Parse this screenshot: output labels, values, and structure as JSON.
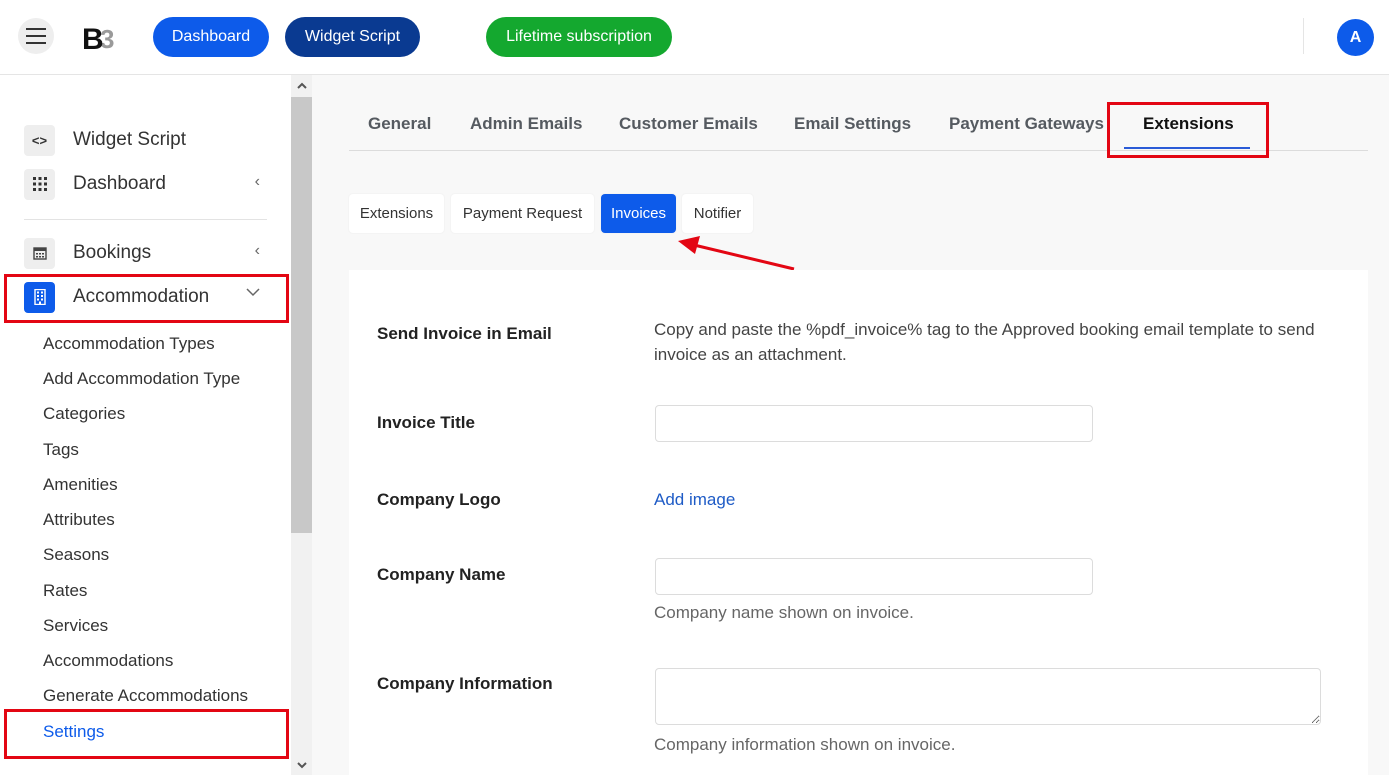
{
  "header": {
    "logo_text": "B3",
    "buttons": {
      "dashboard": "Dashboard",
      "widget_script": "Widget Script",
      "lifetime": "Lifetime subscription"
    },
    "avatar_initial": "A",
    "colors": {
      "primary": "#0d5bea",
      "dark_blue": "#0a3a91",
      "green": "#14a82f"
    }
  },
  "sidebar": {
    "items": [
      {
        "label": "Widget Script",
        "icon": "code-icon"
      },
      {
        "label": "Dashboard",
        "icon": "grid-icon"
      },
      {
        "label": "Bookings",
        "icon": "calendar-icon"
      },
      {
        "label": "Accommodation",
        "icon": "building-icon"
      }
    ],
    "submenu": [
      "Accommodation Types",
      "Add Accommodation Type",
      "Categories",
      "Tags",
      "Amenities",
      "Attributes",
      "Seasons",
      "Rates",
      "Services",
      "Accommodations",
      "Generate Accommodations",
      "Settings"
    ],
    "active_submenu": "Settings"
  },
  "tabs": {
    "main": [
      "General",
      "Admin Emails",
      "Customer Emails",
      "Email Settings",
      "Payment Gateways",
      "Extensions"
    ],
    "active_main": "Extensions",
    "sub": [
      "Extensions",
      "Payment Request",
      "Invoices",
      "Notifier"
    ],
    "active_sub": "Invoices"
  },
  "form": {
    "send_invoice": {
      "label": "Send Invoice in Email",
      "text": "Copy and paste the %pdf_invoice% tag to the Approved booking email template to send invoice as an attachment."
    },
    "invoice_title": {
      "label": "Invoice Title",
      "value": ""
    },
    "company_logo": {
      "label": "Company Logo",
      "link": "Add image"
    },
    "company_name": {
      "label": "Company Name",
      "value": "",
      "help": "Company name shown on invoice."
    },
    "company_info": {
      "label": "Company Information",
      "value": "",
      "help": "Company information shown on invoice."
    }
  }
}
